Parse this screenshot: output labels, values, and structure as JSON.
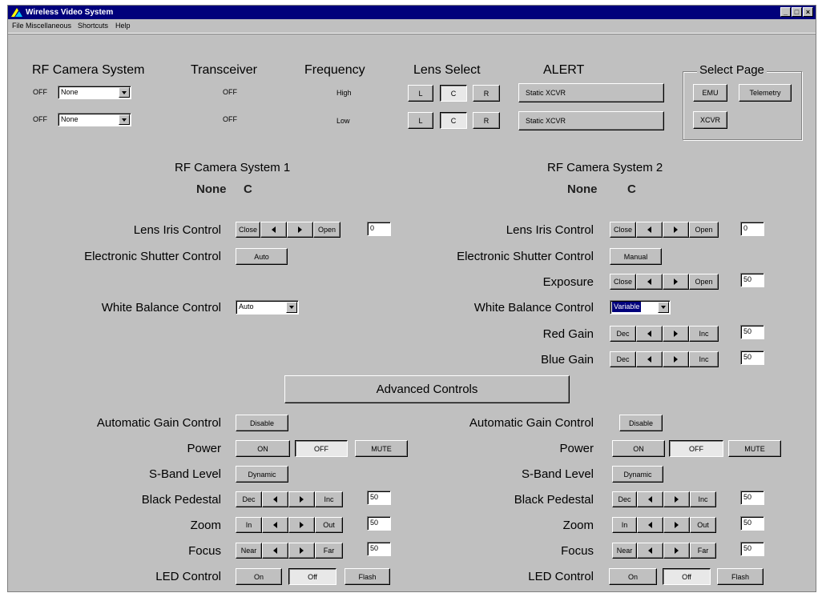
{
  "window": {
    "title": "Wireless Video System",
    "minimize": "_",
    "maximize": "□",
    "close": "×"
  },
  "menu": [
    "File",
    "Miscellaneous",
    "Shortcuts",
    "Help"
  ],
  "headers": {
    "rf_camera_system": "RF Camera System",
    "transceiver": "Transceiver",
    "frequency": "Frequency",
    "lens_select": "Lens Select",
    "alert": "ALERT"
  },
  "rows": [
    {
      "state": "OFF",
      "camera": "None",
      "transceiver": "OFF",
      "frequency": "High",
      "lens": [
        "L",
        "C",
        "R"
      ],
      "alert": "Static XCVR"
    },
    {
      "state": "OFF",
      "camera": "None",
      "transceiver": "OFF",
      "frequency": "Low",
      "lens": [
        "L",
        "C",
        "R"
      ],
      "alert": "Static XCVR"
    }
  ],
  "select_page": {
    "title": "Select Page",
    "emu": "EMU",
    "telemetry": "Telemetry",
    "xcvr": "XCVR"
  },
  "advanced_controls": "Advanced Controls",
  "cam1": {
    "title": "RF Camera System 1",
    "name": "None",
    "lens": "C",
    "iris": {
      "label": "Lens Iris Control",
      "left": "Close",
      "right": "Open",
      "value": "0"
    },
    "shutter": {
      "label": "Electronic Shutter Control",
      "value": "Auto"
    },
    "wb": {
      "label": "White Balance Control",
      "value": "Auto"
    },
    "agc": {
      "label": "Automatic Gain Control",
      "value": "Disable"
    },
    "power": {
      "label": "Power",
      "on": "ON",
      "off": "OFF",
      "mute": "MUTE"
    },
    "sband": {
      "label": "S-Band Level",
      "value": "Dynamic"
    },
    "pedestal": {
      "label": "Black Pedestal",
      "left": "Dec",
      "right": "Inc",
      "value": "50"
    },
    "zoom": {
      "label": "Zoom",
      "left": "In",
      "right": "Out",
      "value": "50"
    },
    "focus": {
      "label": "Focus",
      "left": "Near",
      "right": "Far",
      "value": "50"
    },
    "led": {
      "label": "LED Control",
      "on": "On",
      "off": "Off",
      "flash": "Flash"
    }
  },
  "cam2": {
    "title": "RF Camera System 2",
    "name": "None",
    "lens": "C",
    "iris": {
      "label": "Lens Iris Control",
      "left": "Close",
      "right": "Open",
      "value": "0"
    },
    "shutter": {
      "label": "Electronic Shutter Control",
      "value": "Manual"
    },
    "exposure": {
      "label": "Exposure",
      "left": "Close",
      "right": "Open",
      "value": "50"
    },
    "wb": {
      "label": "White Balance Control",
      "value": "Variable"
    },
    "red": {
      "label": "Red Gain",
      "left": "Dec",
      "right": "Inc",
      "value": "50"
    },
    "blue": {
      "label": "Blue Gain",
      "left": "Dec",
      "right": "Inc",
      "value": "50"
    },
    "agc": {
      "label": "Automatic Gain Control",
      "value": "Disable"
    },
    "power": {
      "label": "Power",
      "on": "ON",
      "off": "OFF",
      "mute": "MUTE"
    },
    "sband": {
      "label": "S-Band Level",
      "value": "Dynamic"
    },
    "pedestal": {
      "label": "Black Pedestal",
      "left": "Dec",
      "right": "Inc",
      "value": "50"
    },
    "zoom": {
      "label": "Zoom",
      "left": "In",
      "right": "Out",
      "value": "50"
    },
    "focus": {
      "label": "Focus",
      "left": "Near",
      "right": "Far",
      "value": "50"
    },
    "led": {
      "label": "LED Control",
      "on": "On",
      "off": "Off",
      "flash": "Flash"
    }
  }
}
